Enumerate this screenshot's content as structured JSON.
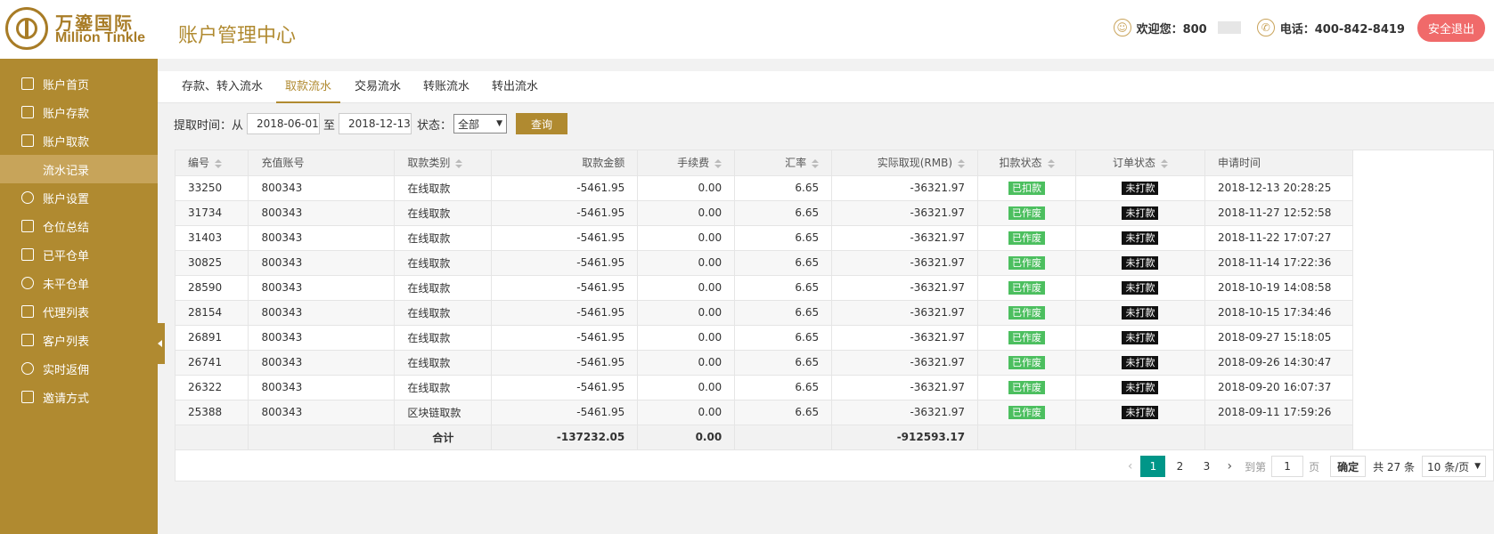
{
  "brand": {
    "name_cn": "万鎏国际",
    "name_en": "Million Tinkle"
  },
  "header": {
    "title": "账户管理中心",
    "welcome_label": "欢迎您：800",
    "phone_label": "电话：400-842-8419",
    "logout_label": "安全退出"
  },
  "sidebar": {
    "items": [
      {
        "label": "账户首页",
        "icon": "home-icon"
      },
      {
        "label": "账户存款",
        "icon": "deposit-icon"
      },
      {
        "label": "账户取款",
        "icon": "withdraw-icon"
      },
      {
        "label": "流水记录",
        "icon": "",
        "active": true
      },
      {
        "label": "账户设置",
        "icon": "gear-icon"
      },
      {
        "label": "仓位总结",
        "icon": "summary-icon"
      },
      {
        "label": "已平仓单",
        "icon": "closed-icon"
      },
      {
        "label": "未平仓单",
        "icon": "open-icon"
      },
      {
        "label": "代理列表",
        "icon": "agent-icon"
      },
      {
        "label": "客户列表",
        "icon": "customer-icon"
      },
      {
        "label": "实时返佣",
        "icon": "dollar-icon"
      },
      {
        "label": "邀请方式",
        "icon": "invite-icon"
      }
    ]
  },
  "tabs": [
    {
      "label": "存款、转入流水"
    },
    {
      "label": "取款流水",
      "active": true
    },
    {
      "label": "交易流水"
    },
    {
      "label": "转账流水"
    },
    {
      "label": "转出流水"
    }
  ],
  "filter": {
    "time_label": "提取时间：从",
    "from_date": "2018-06-01",
    "to_label": "至",
    "to_date": "2018-12-13",
    "status_label": "状态：",
    "status_value": "全部",
    "query_label": "查询"
  },
  "table": {
    "columns": [
      "编号",
      "充值账号",
      "取款类别",
      "取款金额",
      "手续费",
      "汇率",
      "实际取现(RMB)",
      "扣款状态",
      "订单状态",
      "申请时间"
    ],
    "rows": [
      [
        "33250",
        "800343",
        "在线取款",
        "-5461.95",
        "0.00",
        "6.65",
        "-36321.97",
        "已扣款",
        "未打款",
        "2018-12-13 20:28:25"
      ],
      [
        "31734",
        "800343",
        "在线取款",
        "-5461.95",
        "0.00",
        "6.65",
        "-36321.97",
        "已作废",
        "未打款",
        "2018-11-27 12:52:58"
      ],
      [
        "31403",
        "800343",
        "在线取款",
        "-5461.95",
        "0.00",
        "6.65",
        "-36321.97",
        "已作废",
        "未打款",
        "2018-11-22 17:07:27"
      ],
      [
        "30825",
        "800343",
        "在线取款",
        "-5461.95",
        "0.00",
        "6.65",
        "-36321.97",
        "已作废",
        "未打款",
        "2018-11-14 17:22:36"
      ],
      [
        "28590",
        "800343",
        "在线取款",
        "-5461.95",
        "0.00",
        "6.65",
        "-36321.97",
        "已作废",
        "未打款",
        "2018-10-19 14:08:58"
      ],
      [
        "28154",
        "800343",
        "在线取款",
        "-5461.95",
        "0.00",
        "6.65",
        "-36321.97",
        "已作废",
        "未打款",
        "2018-10-15 17:34:46"
      ],
      [
        "26891",
        "800343",
        "在线取款",
        "-5461.95",
        "0.00",
        "6.65",
        "-36321.97",
        "已作废",
        "未打款",
        "2018-09-27 15:18:05"
      ],
      [
        "26741",
        "800343",
        "在线取款",
        "-5461.95",
        "0.00",
        "6.65",
        "-36321.97",
        "已作废",
        "未打款",
        "2018-09-26 14:30:47"
      ],
      [
        "26322",
        "800343",
        "在线取款",
        "-5461.95",
        "0.00",
        "6.65",
        "-36321.97",
        "已作废",
        "未打款",
        "2018-09-20 16:07:37"
      ],
      [
        "25388",
        "800343",
        "区块链取款",
        "-5461.95",
        "0.00",
        "6.65",
        "-36321.97",
        "已作废",
        "未打款",
        "2018-09-11 17:59:26"
      ]
    ],
    "total": {
      "label": "合计",
      "amount": "-137232.05",
      "fee": "0.00",
      "actual": "-912593.17"
    }
  },
  "pagination": {
    "pages": [
      "1",
      "2",
      "3"
    ],
    "current": "1",
    "goto_label": "到第",
    "goto_value": "1",
    "page_unit": "页",
    "confirm_label": "确定",
    "total_label": "共 27 条",
    "page_size": "10 条/页"
  },
  "colors": {
    "brand": "#b08a30",
    "logout": "#f06a6a",
    "active_page": "#009688",
    "badge_green": "#4cbf5f"
  }
}
